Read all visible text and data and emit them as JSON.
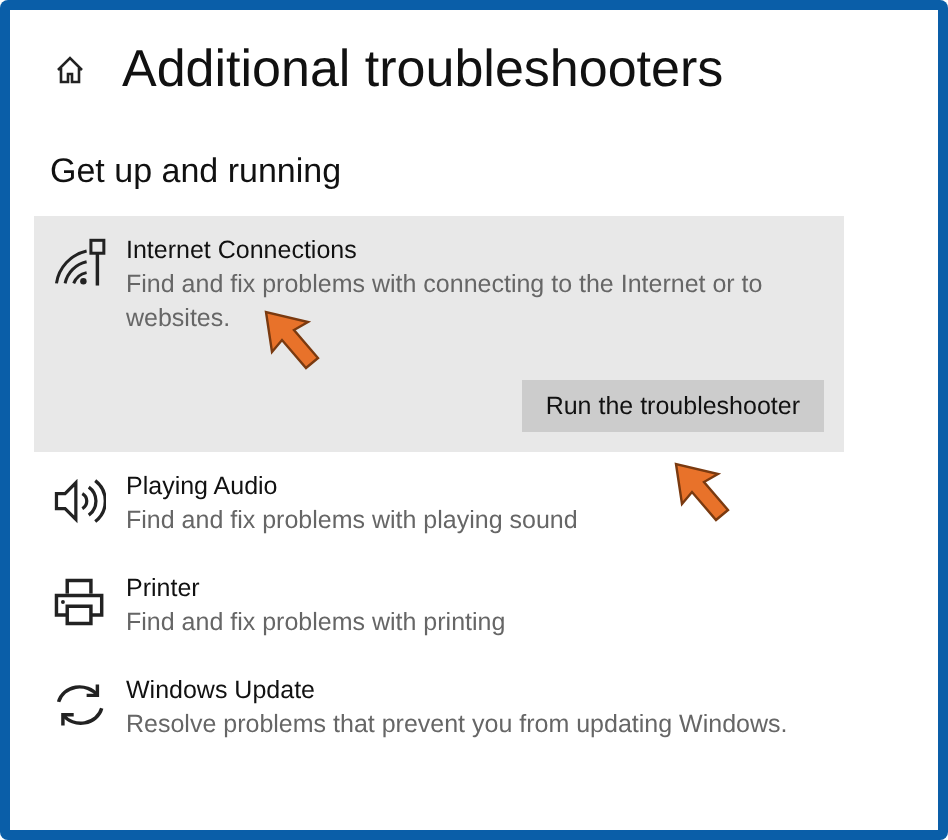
{
  "page": {
    "title": "Additional troubleshooters"
  },
  "section": {
    "heading": "Get up and running"
  },
  "troubleshooters": [
    {
      "kind": "network",
      "title": "Internet Connections",
      "description": "Find and fix problems with connecting to the Internet or to websites.",
      "selected": true,
      "button": "Run the troubleshooter"
    },
    {
      "kind": "audio",
      "title": "Playing Audio",
      "description": "Find and fix problems with playing sound",
      "selected": false
    },
    {
      "kind": "printer",
      "title": "Printer",
      "description": "Find and fix problems with printing",
      "selected": false
    },
    {
      "kind": "update",
      "title": "Windows Update",
      "description": "Resolve problems that prevent you from updating Windows.",
      "selected": false
    }
  ]
}
